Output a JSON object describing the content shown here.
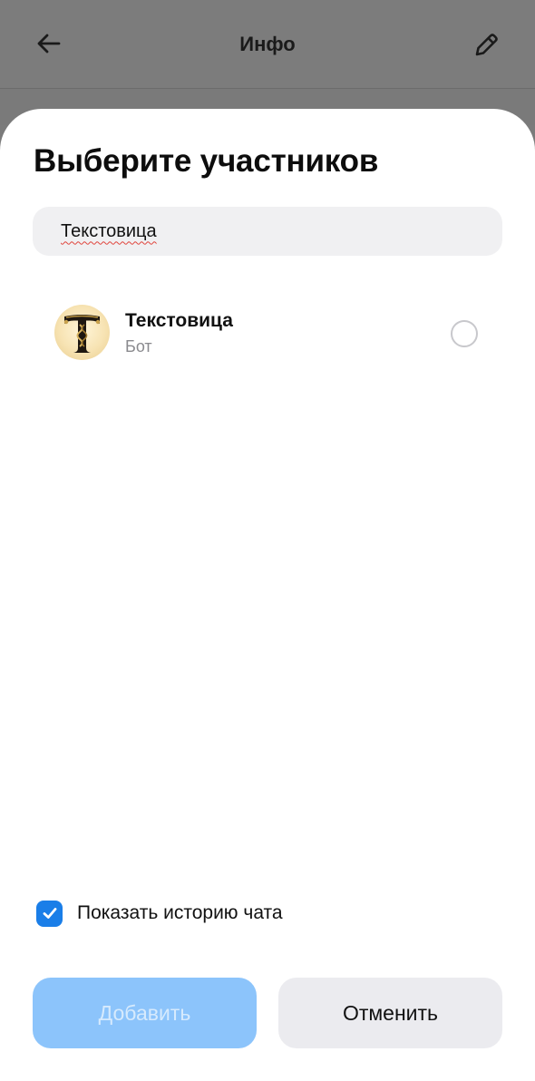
{
  "header": {
    "title": "Инфо",
    "back_icon": "arrow-left-icon",
    "edit_icon": "pencil-icon"
  },
  "sheet": {
    "title": "Выберите участников",
    "search": {
      "value": "Текстовица"
    },
    "contacts": [
      {
        "name": "Текстовица",
        "subtitle": "Бот",
        "avatar_icon": "ornate-letter-t-icon",
        "selected": false
      }
    ],
    "history_option": {
      "label": "Показать историю чата",
      "checked": true
    },
    "buttons": {
      "add_label": "Добавить",
      "cancel_label": "Отменить"
    }
  },
  "colors": {
    "accent": "#1a7ee8",
    "add_button_disabled": "#8cc4fb",
    "cancel_button": "#ebebef",
    "overlay": "#7b7b7b"
  }
}
